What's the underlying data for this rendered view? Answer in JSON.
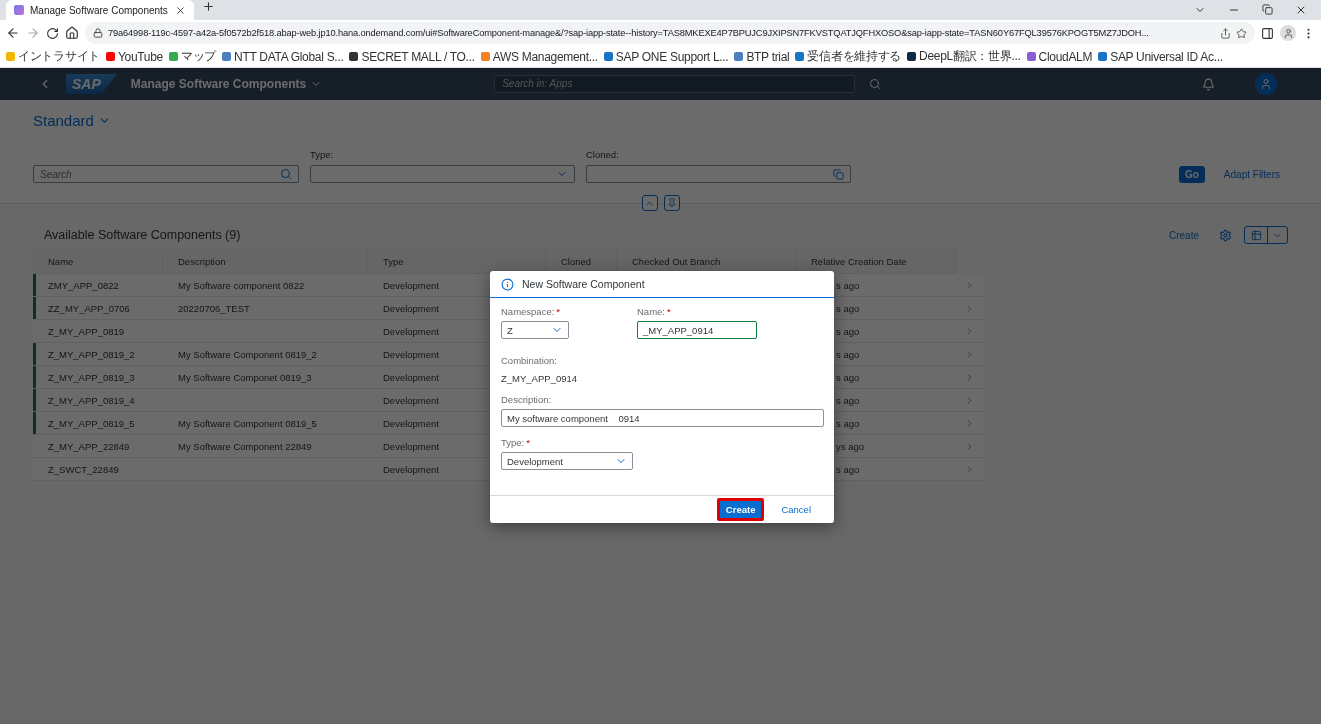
{
  "browser": {
    "tab_title": "Manage Software Components",
    "url": "79a64998-119c-4597-a42a-5f0572b2f518.abap-web.jp10.hana.ondemand.com/ui#SoftwareComponent-manage&/?sap-iapp-state--history=TAS8MKEXE4P7BPUJC9JXIPSN7FKVSTQATJQFHXOSO&sap-iapp-state=TASN60Y67FQL39576KPOGT5MZ7JDOH...",
    "bookmarks": [
      {
        "label": "イントラサイト",
        "color": "#f2b600"
      },
      {
        "label": "YouTube",
        "color": "#ff0000"
      },
      {
        "label": "マップ",
        "color": "#34a853"
      },
      {
        "label": "NTT DATA Global S...",
        "color": "#4a7fc1"
      },
      {
        "label": "SECRET MALL / TO...",
        "color": "#333333"
      },
      {
        "label": "AWS Management...",
        "color": "#f58220"
      },
      {
        "label": "SAP ONE Support L...",
        "color": "#1a73c8"
      },
      {
        "label": "BTP trial",
        "color": "#4a7fc1"
      },
      {
        "label": "受信者を維持する",
        "color": "#1a73c8"
      },
      {
        "label": "DeepL翻訳：世界...",
        "color": "#0f2b46"
      },
      {
        "label": "CloudALM",
        "color": "#8a5cd6"
      },
      {
        "label": "SAP Universal ID Ac...",
        "color": "#1a73c8"
      }
    ]
  },
  "shell": {
    "logo": "SAP",
    "title": "Manage Software Components",
    "search_placeholder": "Search in: Apps"
  },
  "variant": "Standard",
  "filters": {
    "search_placeholder": "Search",
    "type_label": "Type:",
    "cloned_label": "Cloned:",
    "go": "Go",
    "adapt": "Adapt Filters"
  },
  "table": {
    "title": "Available Software Components (9)",
    "create": "Create",
    "columns": [
      "Name",
      "Description",
      "Type",
      "Cloned",
      "Checked Out Branch",
      "Relative Creation Date"
    ],
    "rows": [
      {
        "name": "ZMY_APP_0822",
        "description": "My Software component 0822",
        "type": "Development",
        "date": "s ago",
        "highlighted": true
      },
      {
        "name": "ZZ_MY_APP_0706",
        "description": "20220706_TEST",
        "type": "Development",
        "date": "s ago",
        "highlighted": true
      },
      {
        "name": "Z_MY_APP_0819",
        "type": "Development",
        "date": "s ago",
        "highlighted": false
      },
      {
        "name": "Z_MY_APP_0819_2",
        "description": "My Software Component 0819_2",
        "type": "Development",
        "date": "s ago",
        "highlighted": true
      },
      {
        "name": "Z_MY_APP_0819_3",
        "description": "My Software Componet 0819_3",
        "type": "Development",
        "date": "s ago",
        "highlighted": true
      },
      {
        "name": "Z_MY_APP_0819_4",
        "type": "Development",
        "date": "s ago",
        "highlighted": true
      },
      {
        "name": "Z_MY_APP_0819_5",
        "description": "My Software Component 0819_5",
        "type": "Development",
        "date": "s ago",
        "highlighted": true
      },
      {
        "name": "Z_MY_APP_22849",
        "description": "My Software Component 22849",
        "type": "Development",
        "date": "ys ago",
        "highlighted": false
      },
      {
        "name": "Z_SWCT_22849",
        "type": "Development",
        "date": "s ago",
        "highlighted": false
      }
    ]
  },
  "dialog": {
    "title": "New Software Component",
    "namespace": {
      "label": "Namespace:",
      "mark": "*",
      "value": "Z"
    },
    "name": {
      "label": "Name:",
      "mark": "*",
      "value": "_MY_APP_0914"
    },
    "combination": {
      "label": "Combination:",
      "value": "Z_MY_APP_0914"
    },
    "description": {
      "label": "Description:",
      "value": "My software component    0914"
    },
    "type": {
      "label": "Type:",
      "mark": "*",
      "value": "Development"
    },
    "buttons": [
      {
        "kind": "primary",
        "label": "Create",
        "highlighted": true
      },
      {
        "kind": "plain",
        "label": "Cancel",
        "highlighted": false
      }
    ]
  }
}
